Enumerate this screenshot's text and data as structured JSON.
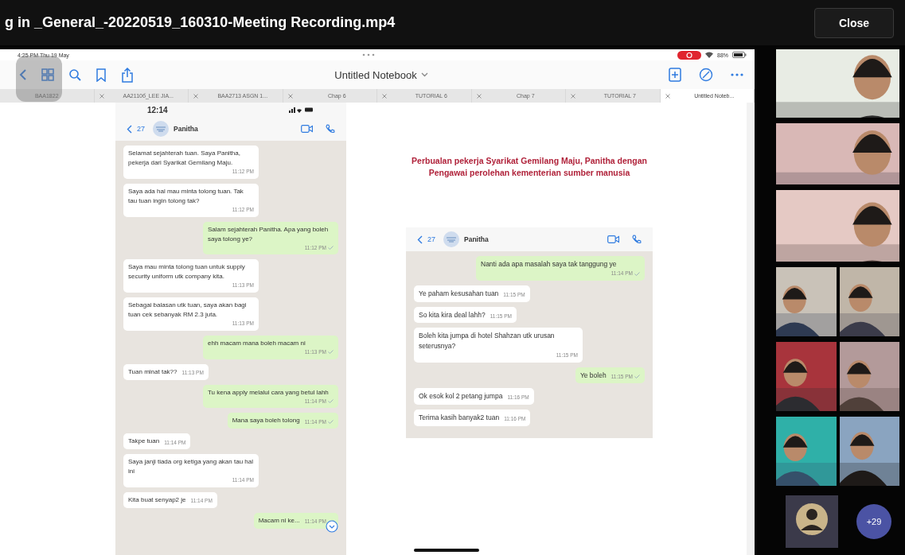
{
  "player": {
    "title": "g in _General_-20220519_160310-Meeting Recording.mp4",
    "close": "Close"
  },
  "ipad": {
    "status_time": "4:25 PM  Thu 19 May",
    "battery": "88%",
    "notebook_title": "Untitled Notebook",
    "tabs": [
      {
        "label": "BAA1822",
        "selected": false
      },
      {
        "label": "AA2110б_LEE JIA...",
        "selected": false
      },
      {
        "label": "BAA2713 ASGN 1...",
        "selected": false
      },
      {
        "label": "Chap 6",
        "selected": false
      },
      {
        "label": "TUTORIAL 6",
        "selected": false
      },
      {
        "label": "Chap 7",
        "selected": false
      },
      {
        "label": "TUTORIAL 7",
        "selected": false
      },
      {
        "label": "Untitled Noteb...",
        "selected": true
      }
    ]
  },
  "page": {
    "heading": "Perbualan pekerja Syarikat Gemilang Maju, Panitha dengan Pengawai perolehan kementerian sumber manusia",
    "chats": [
      {
        "clock": "12:14",
        "back_count": "27",
        "contact": "Panitha",
        "messages": [
          {
            "kind": "in",
            "text": "Selamat sejahterah tuan. Saya Panitha, pekerja dari Syarikat Gemilang Maju.",
            "time": "11:12 PM"
          },
          {
            "kind": "in",
            "text": "Saya ada hal mau minta tolong tuan. Tak tau tuan ingin tolong tak?",
            "time": "11:12 PM"
          },
          {
            "kind": "out",
            "text": "Salam sejahterah Panitha. Apa yang boleh saya tolong ye?",
            "time": "11:12 PM"
          },
          {
            "kind": "in",
            "text": "Saya mau minta tolong tuan untuk supply security uniform utk company kita.",
            "time": "11:13 PM"
          },
          {
            "kind": "in",
            "text": "Sebagai balasan utk tuan, saya akan bagi tuan cek sebanyak RM 2.3 juta.",
            "time": "11:13 PM"
          },
          {
            "kind": "out",
            "text": "ehh macam mana boleh macam ni",
            "time": "11:13 PM"
          },
          {
            "kind": "in",
            "text": "Tuan minat tak??",
            "time": "11:13 PM"
          },
          {
            "kind": "out",
            "text": "Tu kena apply melalui cara yang betul lahh",
            "time": "11:14 PM"
          },
          {
            "kind": "out",
            "text": "Mana saya boleh tolong",
            "time": "11:14 PM"
          },
          {
            "kind": "in",
            "text": "Takpe tuan",
            "time": "11:14 PM"
          },
          {
            "kind": "in",
            "text": "Saya janji tiada org ketiga yang akan tau hal ini",
            "time": "11:14 PM"
          },
          {
            "kind": "in",
            "text": "Kita buat senyap2 je",
            "time": "11:14 PM"
          },
          {
            "kind": "out",
            "text": "Macam ni ke...",
            "time": "11:14 PM"
          }
        ]
      },
      {
        "back_count": "27",
        "contact": "Panitha",
        "messages": [
          {
            "kind": "out",
            "text": "Nanti ada apa masalah saya tak tanggung ye",
            "time": "11:14 PM"
          },
          {
            "kind": "in",
            "text": "Ye paham kesusahan tuan",
            "time": "11:15 PM"
          },
          {
            "kind": "in",
            "text": "So kita kira deal lahh?",
            "time": "11:15 PM"
          },
          {
            "kind": "in",
            "text": "Boleh kita jumpa di hotel Shahzan utk urusan seterusnya?",
            "time": "11:15 PM"
          },
          {
            "kind": "out",
            "text": "Ye boleh",
            "time": "11:15 PM"
          },
          {
            "kind": "in",
            "text": "Ok esok kol 2 petang jumpa",
            "time": "11:16 PM"
          },
          {
            "kind": "in",
            "text": "Terima kasih banyak2 tuan",
            "time": "11:16 PM"
          }
        ]
      }
    ]
  },
  "participants": {
    "avatar": {
      "kind": "avatar"
    },
    "more": "+29"
  }
}
